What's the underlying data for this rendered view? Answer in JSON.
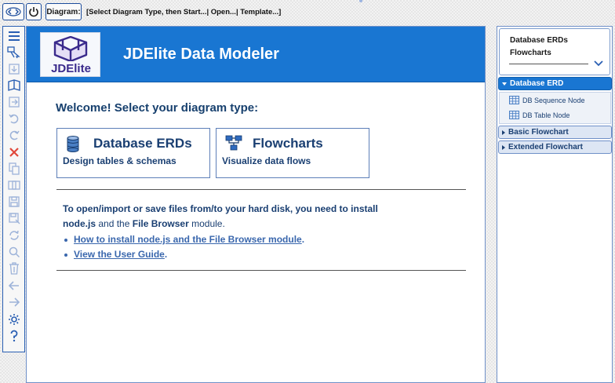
{
  "toolbar_top": {
    "diagram_label": "Diagram:",
    "status": "[Select Diagram Type, then Start...| Open...| Template...]"
  },
  "tools": [
    "menu-icon",
    "pointer-icon",
    "download-icon",
    "open-book-icon",
    "export-icon",
    "undo-icon",
    "redo-icon",
    "delete-icon",
    "copy-icon",
    "cut-icon",
    "save-icon",
    "save-as-icon",
    "refresh-icon",
    "search-icon",
    "trash-icon",
    "back-icon",
    "forward-icon",
    "settings-icon",
    "help-icon"
  ],
  "main": {
    "logo_text": "JDElite",
    "app_title": "JDElite Data Modeler",
    "welcome": "Welcome! Select your diagram type:",
    "cards": {
      "erd": {
        "title": "Database ERDs",
        "subtitle": "Design tables & schemas"
      },
      "flow": {
        "title": "Flowcharts",
        "subtitle": "Visualize data flows"
      }
    },
    "info": {
      "part1": "To open/import or save files from/to your hard disk, you need to install",
      "part2": "node.js",
      "part3": " and the ",
      "part4": "File Browser",
      "part5": " module."
    },
    "links": {
      "install": "How to install node.js and the File Browser module",
      "guide": "View the User Guide"
    }
  },
  "sidebar": {
    "selector": {
      "item1": "Database ERDs",
      "item2": "Flowcharts"
    },
    "sections": {
      "erd": "Database ERD",
      "basic": "Basic Flowchart",
      "extended": "Extended Flowchart"
    },
    "nodes": {
      "sequence": "DB Sequence Node",
      "table": "DB Table Node"
    }
  },
  "colors": {
    "accent": "#1976d2",
    "heading": "#1a3f72",
    "link": "#3a67ad",
    "delete": "#e0483a"
  }
}
